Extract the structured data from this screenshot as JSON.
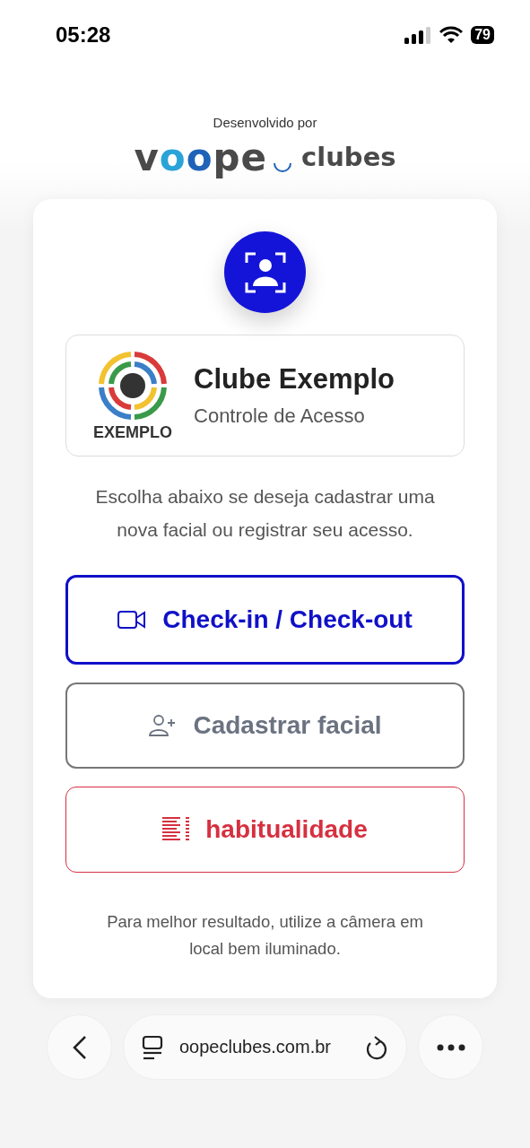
{
  "status_bar": {
    "time": "05:28",
    "battery": "79"
  },
  "developer": {
    "caption": "Desenvolvido por",
    "logo_parts": [
      {
        "text": "v",
        "color": "#4a4a4a"
      },
      {
        "text": "o",
        "color": "#2aa3d8"
      },
      {
        "text": "o",
        "color": "#1e63b8"
      },
      {
        "text": "pe",
        "color": "#4a4a4a"
      }
    ],
    "logo_suffix": "clubes"
  },
  "club": {
    "logo_text": "EXEMPLO",
    "name": "Clube Exemplo",
    "subtitle": "Controle de Acesso"
  },
  "instructions": "Escolha abaixo se deseja cadastrar uma nova facial ou registrar seu acesso.",
  "actions": [
    {
      "kind": "primary",
      "label": "Check-in / Check-out"
    },
    {
      "kind": "secondary",
      "label": "Cadastrar facial"
    },
    {
      "kind": "danger",
      "label": "habitualidade"
    }
  ],
  "tip": "Para melhor resultado, utilize a câmera em local bem iluminado.",
  "browser": {
    "url": "oopeclubes.com.br"
  }
}
